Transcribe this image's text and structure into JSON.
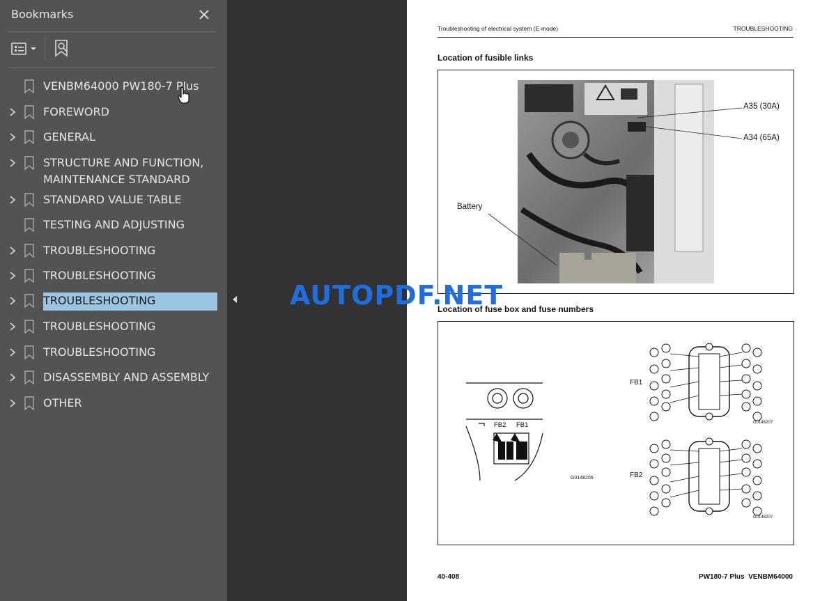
{
  "sidebar": {
    "title": "Bookmarks",
    "close_icon": "close-icon",
    "options_icon": "bookmark-options-icon",
    "find_icon": "find-current-bookmark-icon",
    "items": [
      {
        "label": "VENBM64000 PW180-7 Plus",
        "expandable": false,
        "selected": false
      },
      {
        "label": "FOREWORD",
        "expandable": true,
        "selected": false
      },
      {
        "label": "GENERAL",
        "expandable": true,
        "selected": false
      },
      {
        "label": "STRUCTURE AND FUNCTION,\nMAINTENANCE STANDARD",
        "expandable": true,
        "selected": false
      },
      {
        "label": "STANDARD VALUE TABLE",
        "expandable": true,
        "selected": false
      },
      {
        "label": "TESTING AND ADJUSTING",
        "expandable": false,
        "selected": false
      },
      {
        "label": "TROUBLESHOOTING",
        "expandable": true,
        "selected": false
      },
      {
        "label": "TROUBLESHOOTING",
        "expandable": true,
        "selected": false
      },
      {
        "label": "TROUBLESHOOTING",
        "expandable": true,
        "selected": true
      },
      {
        "label": "TROUBLESHOOTING",
        "expandable": true,
        "selected": false
      },
      {
        "label": "TROUBLESHOOTING",
        "expandable": true,
        "selected": false
      },
      {
        "label": "DISASSEMBLY AND ASSEMBLY",
        "expandable": true,
        "selected": false
      },
      {
        "label": "OTHER",
        "expandable": true,
        "selected": false
      }
    ]
  },
  "page": {
    "header_left": "Troubleshooting of electrical system (E-mode)",
    "header_right": "TROUBLESHOOTING",
    "section1_title": "Location of fusible links",
    "section2_title": "Location of fuse box and fuse numbers",
    "fig1_labels": {
      "a35": "A35 (30A)",
      "a34": "A34 (65A)",
      "battery": "Battery"
    },
    "fig2_labels": {
      "fb1": "FB1",
      "fb2": "FB2",
      "fb2_small": "FB2",
      "fb1_small": "FB1",
      "code_left": "G0148206",
      "code_top": "G0148207",
      "code_bottom": "G0148207"
    },
    "footer_left": "40-408",
    "footer_right": "PW180-7 Plus  VENBM64000"
  },
  "watermark": "AUTOPDF.NET",
  "colors": {
    "sidebar_bg": "#535353",
    "selection": "#9ac4e2",
    "canvas": "#323232",
    "watermark": "#1f6ee0"
  }
}
